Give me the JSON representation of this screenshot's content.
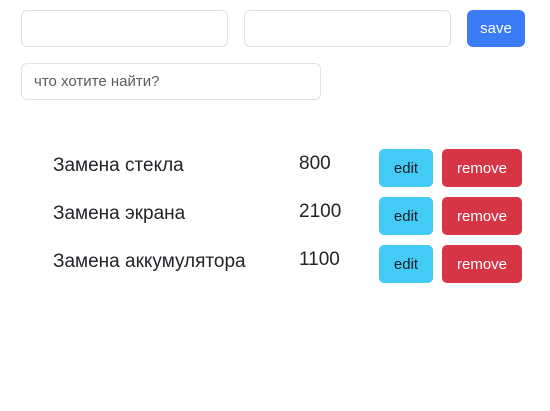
{
  "form": {
    "name_value": "",
    "price_value": "",
    "save_label": "save"
  },
  "search": {
    "placeholder": "что хотите найти?",
    "value": ""
  },
  "items": [
    {
      "name": "Замена стекла",
      "price": "800",
      "edit_label": "edit",
      "remove_label": "remove"
    },
    {
      "name": "Замена экрана",
      "price": "2100",
      "edit_label": "edit",
      "remove_label": "remove"
    },
    {
      "name": "Замена аккумулятора",
      "price": "1100",
      "edit_label": "edit",
      "remove_label": "remove"
    }
  ],
  "colors": {
    "save_button": "#3a7bf6",
    "edit_button": "#43cbf6",
    "remove_button": "#d63545",
    "input_border": "#dee2e6"
  }
}
